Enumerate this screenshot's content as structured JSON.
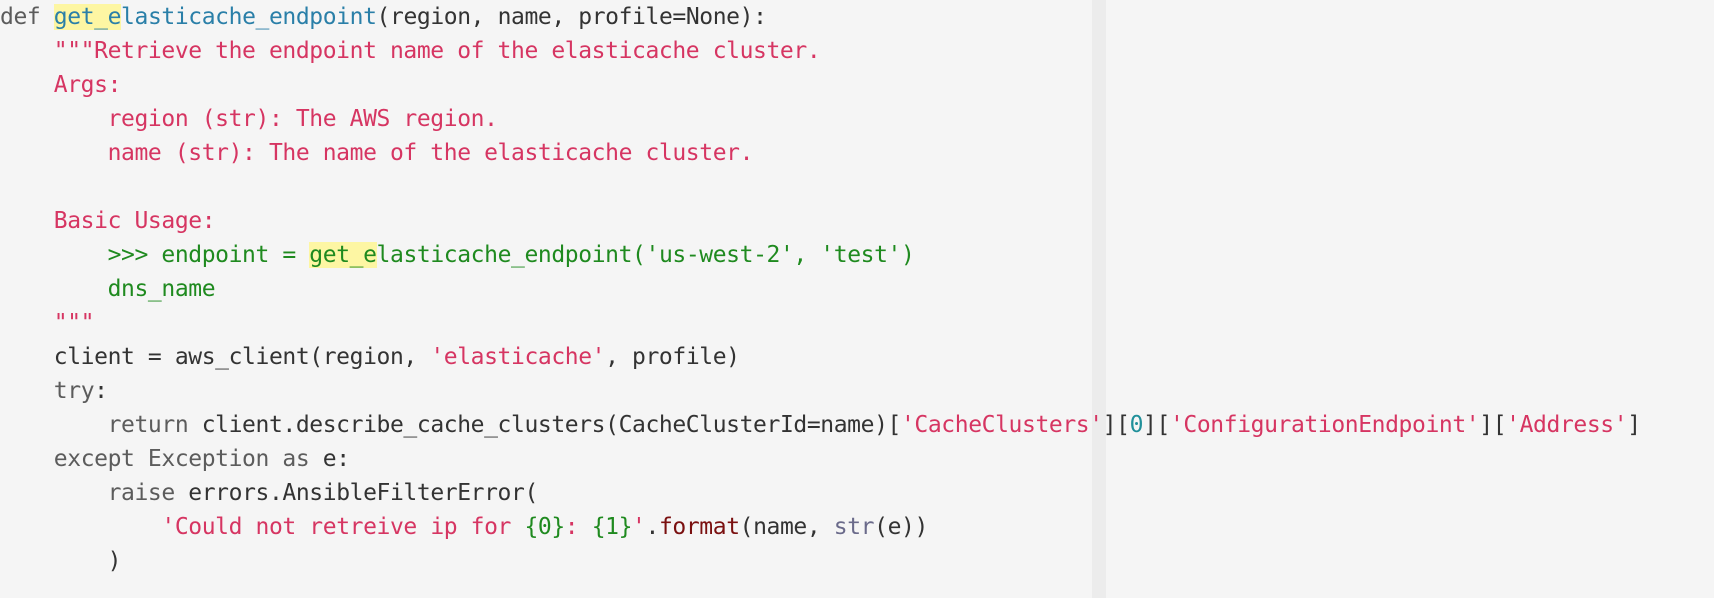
{
  "editor": {
    "search_highlight": "get_e",
    "lines": [
      {
        "tokens": [
          {
            "text": "def ",
            "kind": "keyword"
          },
          {
            "text": "get_e",
            "kind": "fname",
            "highlight": true
          },
          {
            "text": "lasticache_endpoint",
            "kind": "fname"
          },
          {
            "text": "(region, name, profile=None):",
            "kind": "plain"
          }
        ]
      },
      {
        "tokens": [
          {
            "text": "    \"\"\"Retrieve the endpoint name of the elasticache cluster.",
            "kind": "string"
          }
        ]
      },
      {
        "tokens": [
          {
            "text": "    Args:",
            "kind": "string"
          }
        ]
      },
      {
        "tokens": [
          {
            "text": "        region (str): The AWS region.",
            "kind": "string"
          }
        ]
      },
      {
        "tokens": [
          {
            "text": "        name (str): The name of the elasticache cluster.",
            "kind": "string"
          }
        ]
      },
      {
        "tokens": [
          {
            "text": "",
            "kind": "plain"
          }
        ]
      },
      {
        "tokens": [
          {
            "text": "    Basic Usage:",
            "kind": "string"
          }
        ]
      },
      {
        "tokens": [
          {
            "text": "        >>> endpoint = ",
            "kind": "doctest"
          },
          {
            "text": "get_e",
            "kind": "doctest",
            "highlight": true
          },
          {
            "text": "lasticache_endpoint('us-west-2', 'test')",
            "kind": "doctest"
          }
        ]
      },
      {
        "tokens": [
          {
            "text": "        dns_name",
            "kind": "doctest"
          }
        ]
      },
      {
        "tokens": [
          {
            "text": "    \"\"\"",
            "kind": "string"
          }
        ]
      },
      {
        "tokens": [
          {
            "text": "    client = aws_client(region, ",
            "kind": "plain"
          },
          {
            "text": "'elasticache'",
            "kind": "string"
          },
          {
            "text": ", profile)",
            "kind": "plain"
          }
        ]
      },
      {
        "tokens": [
          {
            "text": "    ",
            "kind": "plain"
          },
          {
            "text": "try",
            "kind": "keyword"
          },
          {
            "text": ":",
            "kind": "plain"
          }
        ]
      },
      {
        "tokens": [
          {
            "text": "        ",
            "kind": "plain"
          },
          {
            "text": "return",
            "kind": "keyword"
          },
          {
            "text": " client.describe_cache_clusters(CacheClusterId=name)[",
            "kind": "plain"
          },
          {
            "text": "'CacheClusters'",
            "kind": "string"
          },
          {
            "text": "][",
            "kind": "plain"
          },
          {
            "text": "0",
            "kind": "number"
          },
          {
            "text": "][",
            "kind": "plain"
          },
          {
            "text": "'ConfigurationEndpoint'",
            "kind": "string"
          },
          {
            "text": "][",
            "kind": "plain"
          },
          {
            "text": "'Address'",
            "kind": "string"
          },
          {
            "text": "]",
            "kind": "plain"
          }
        ]
      },
      {
        "tokens": [
          {
            "text": "    ",
            "kind": "plain"
          },
          {
            "text": "except Exception as",
            "kind": "keyword"
          },
          {
            "text": " e:",
            "kind": "plain"
          }
        ]
      },
      {
        "tokens": [
          {
            "text": "        ",
            "kind": "plain"
          },
          {
            "text": "raise",
            "kind": "keyword"
          },
          {
            "text": " errors.AnsibleFilterError(",
            "kind": "plain"
          }
        ]
      },
      {
        "tokens": [
          {
            "text": "            ",
            "kind": "plain"
          },
          {
            "text": "'Could not retreive ip for ",
            "kind": "string"
          },
          {
            "text": "{0}",
            "kind": "format"
          },
          {
            "text": ": ",
            "kind": "string"
          },
          {
            "text": "{1}",
            "kind": "format"
          },
          {
            "text": "'",
            "kind": "string"
          },
          {
            "text": ".",
            "kind": "plain"
          },
          {
            "text": "format",
            "kind": "method"
          },
          {
            "text": "(name, ",
            "kind": "plain"
          },
          {
            "text": "str",
            "kind": "builtin"
          },
          {
            "text": "(e))",
            "kind": "plain"
          }
        ]
      },
      {
        "tokens": [
          {
            "text": "        )",
            "kind": "plain"
          }
        ]
      }
    ]
  },
  "colors": {
    "background": "#f5f5f5",
    "margin_guide": "#ececec",
    "keyword": "#5c5c5c",
    "function_name": "#2a7fa8",
    "string": "#d63562",
    "doctest": "#1f8a1f",
    "number": "#20909a",
    "search_highlight": "#fdf6a3"
  }
}
